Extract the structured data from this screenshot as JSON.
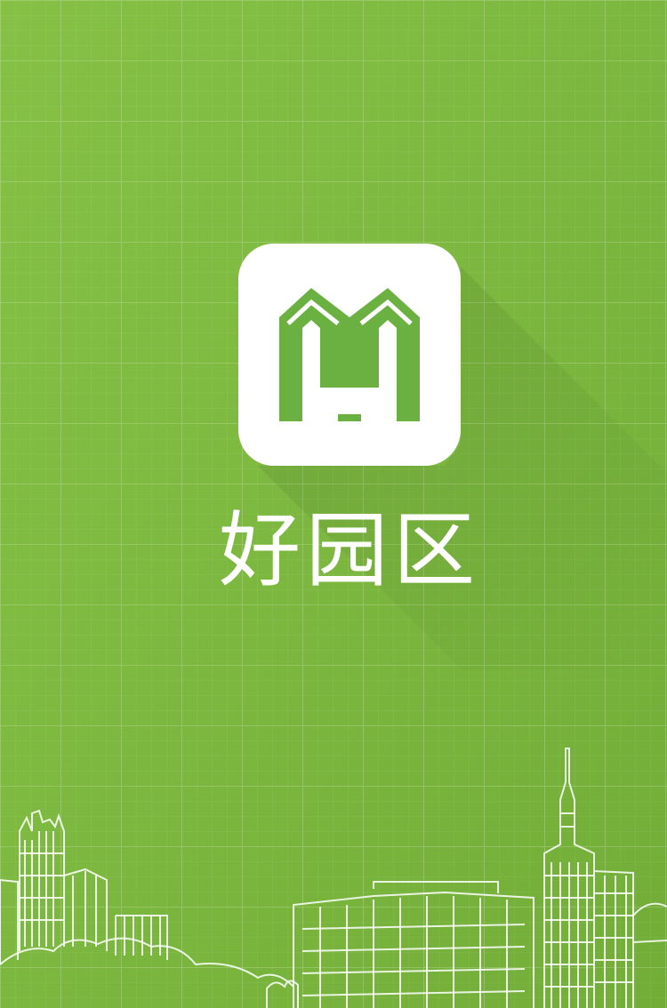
{
  "splash": {
    "app_name": "好园区",
    "logo_icon": "hh-building-logo-icon",
    "background_color": "#7cb83f",
    "logo_color": "#6ab142",
    "text_color": "#ffffff"
  }
}
